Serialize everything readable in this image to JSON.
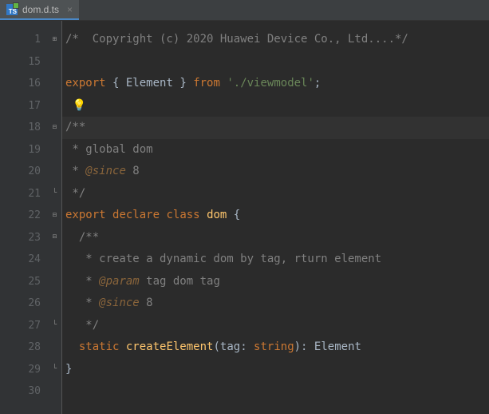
{
  "tab": {
    "filename": "dom.d.ts",
    "icon_label": "TS"
  },
  "current_line": 18,
  "lines": [
    {
      "n": 1,
      "fold": "plus",
      "tokens": [
        [
          "cmt",
          "/*  Copyright (c) 2020 Huawei Device Co., Ltd....*/"
        ]
      ]
    },
    {
      "n": 15,
      "tokens": []
    },
    {
      "n": 16,
      "tokens": [
        [
          "kw",
          "export"
        ],
        [
          "",
          ", "
        ],
        [
          "",
          "{"
        ],
        [
          "",
          ", "
        ],
        [
          "ident",
          "Element"
        ],
        [
          "",
          ", "
        ],
        [
          "",
          "}"
        ],
        [
          "",
          ", "
        ],
        [
          "kw",
          "from"
        ],
        [
          "",
          ", "
        ],
        [
          "str",
          "'./viewmodel'"
        ],
        [
          "punct",
          ";"
        ]
      ],
      "raw": true
    },
    {
      "n": 17,
      "bulb": true,
      "tokens": []
    },
    {
      "n": 18,
      "fold": "minus",
      "tokens": [
        [
          "cmt",
          "/**"
        ]
      ]
    },
    {
      "n": 19,
      "tokens": [
        [
          "cmt",
          " * global dom"
        ]
      ]
    },
    {
      "n": 20,
      "tokens": [
        [
          "cmt",
          " * "
        ],
        [
          "tag-param",
          "@since"
        ],
        [
          "cmt",
          " 8"
        ]
      ]
    },
    {
      "n": 21,
      "fold": "up",
      "tokens": [
        [
          "cmt",
          " */"
        ]
      ]
    },
    {
      "n": 22,
      "fold": "minus",
      "tokens": [
        [
          "kw",
          "export"
        ],
        [
          "",
          ", "
        ],
        [
          "kw",
          "declare"
        ],
        [
          "",
          ", "
        ],
        [
          "kw",
          "class"
        ],
        [
          "",
          ", "
        ],
        [
          "cls",
          "dom"
        ],
        [
          "",
          ", "
        ],
        [
          "brace",
          "{"
        ]
      ]
    },
    {
      "n": 23,
      "fold": "minus",
      "indent": 2,
      "tokens": [
        [
          "cmt",
          "/**"
        ]
      ]
    },
    {
      "n": 24,
      "indent": 2,
      "tokens": [
        [
          "cmt",
          " * create a dynamic dom by tag, rturn element"
        ]
      ]
    },
    {
      "n": 25,
      "indent": 2,
      "tokens": [
        [
          "cmt",
          " * "
        ],
        [
          "tag-param",
          "@param"
        ],
        [
          "cmt",
          " tag dom tag"
        ]
      ]
    },
    {
      "n": 26,
      "indent": 2,
      "tokens": [
        [
          "cmt",
          " * "
        ],
        [
          "tag-param",
          "@since"
        ],
        [
          "cmt",
          " 8"
        ]
      ]
    },
    {
      "n": 27,
      "fold": "up",
      "indent": 2,
      "tokens": [
        [
          "cmt",
          " */"
        ]
      ]
    },
    {
      "n": 28,
      "indent": 2,
      "tokens": [
        [
          "kw",
          "static"
        ],
        [
          "",
          ", "
        ],
        [
          "fn",
          "createElement"
        ],
        [
          "punct",
          "("
        ],
        [
          "ident",
          "tag"
        ],
        [
          "punct",
          ": "
        ],
        [
          "type",
          "string"
        ],
        [
          "punct",
          "): "
        ],
        [
          "ident",
          "Element"
        ]
      ]
    },
    {
      "n": 29,
      "fold": "up",
      "tokens": [
        [
          "brace",
          "}"
        ]
      ]
    },
    {
      "n": 30,
      "tokens": []
    }
  ]
}
